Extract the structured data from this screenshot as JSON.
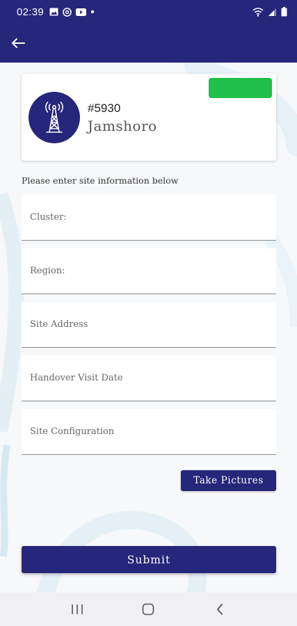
{
  "status_bar": {
    "time": "02:39",
    "left_icons": [
      "gallery-icon",
      "at-sign-icon",
      "youtube-icon",
      "dot-icon"
    ],
    "right_icons": [
      "wifi-icon",
      "signal-icon",
      "battery-icon"
    ]
  },
  "app_bar": {
    "back_icon": "arrow-left-icon"
  },
  "site_card": {
    "site_id": "#5930",
    "site_name": "Jamshoro",
    "avatar_icon": "cell-tower-icon",
    "status_color": "#1fbf4a"
  },
  "form": {
    "instructions": "Please enter site information below",
    "fields": [
      {
        "placeholder": "Cluster:",
        "value": ""
      },
      {
        "placeholder": "Region:",
        "value": ""
      },
      {
        "placeholder": "Site Address",
        "value": ""
      },
      {
        "placeholder": "Handover Visit Date",
        "value": ""
      },
      {
        "placeholder": "Site Configuration",
        "value": ""
      }
    ],
    "take_pictures_label": "Take Pictures",
    "submit_label": "Submit"
  },
  "nav_bar": {
    "buttons": [
      "recent-apps-icon",
      "home-icon",
      "back-icon"
    ]
  },
  "colors": {
    "primary": "#26267a",
    "success": "#1fbf4a",
    "background": "#f7f8fa"
  }
}
